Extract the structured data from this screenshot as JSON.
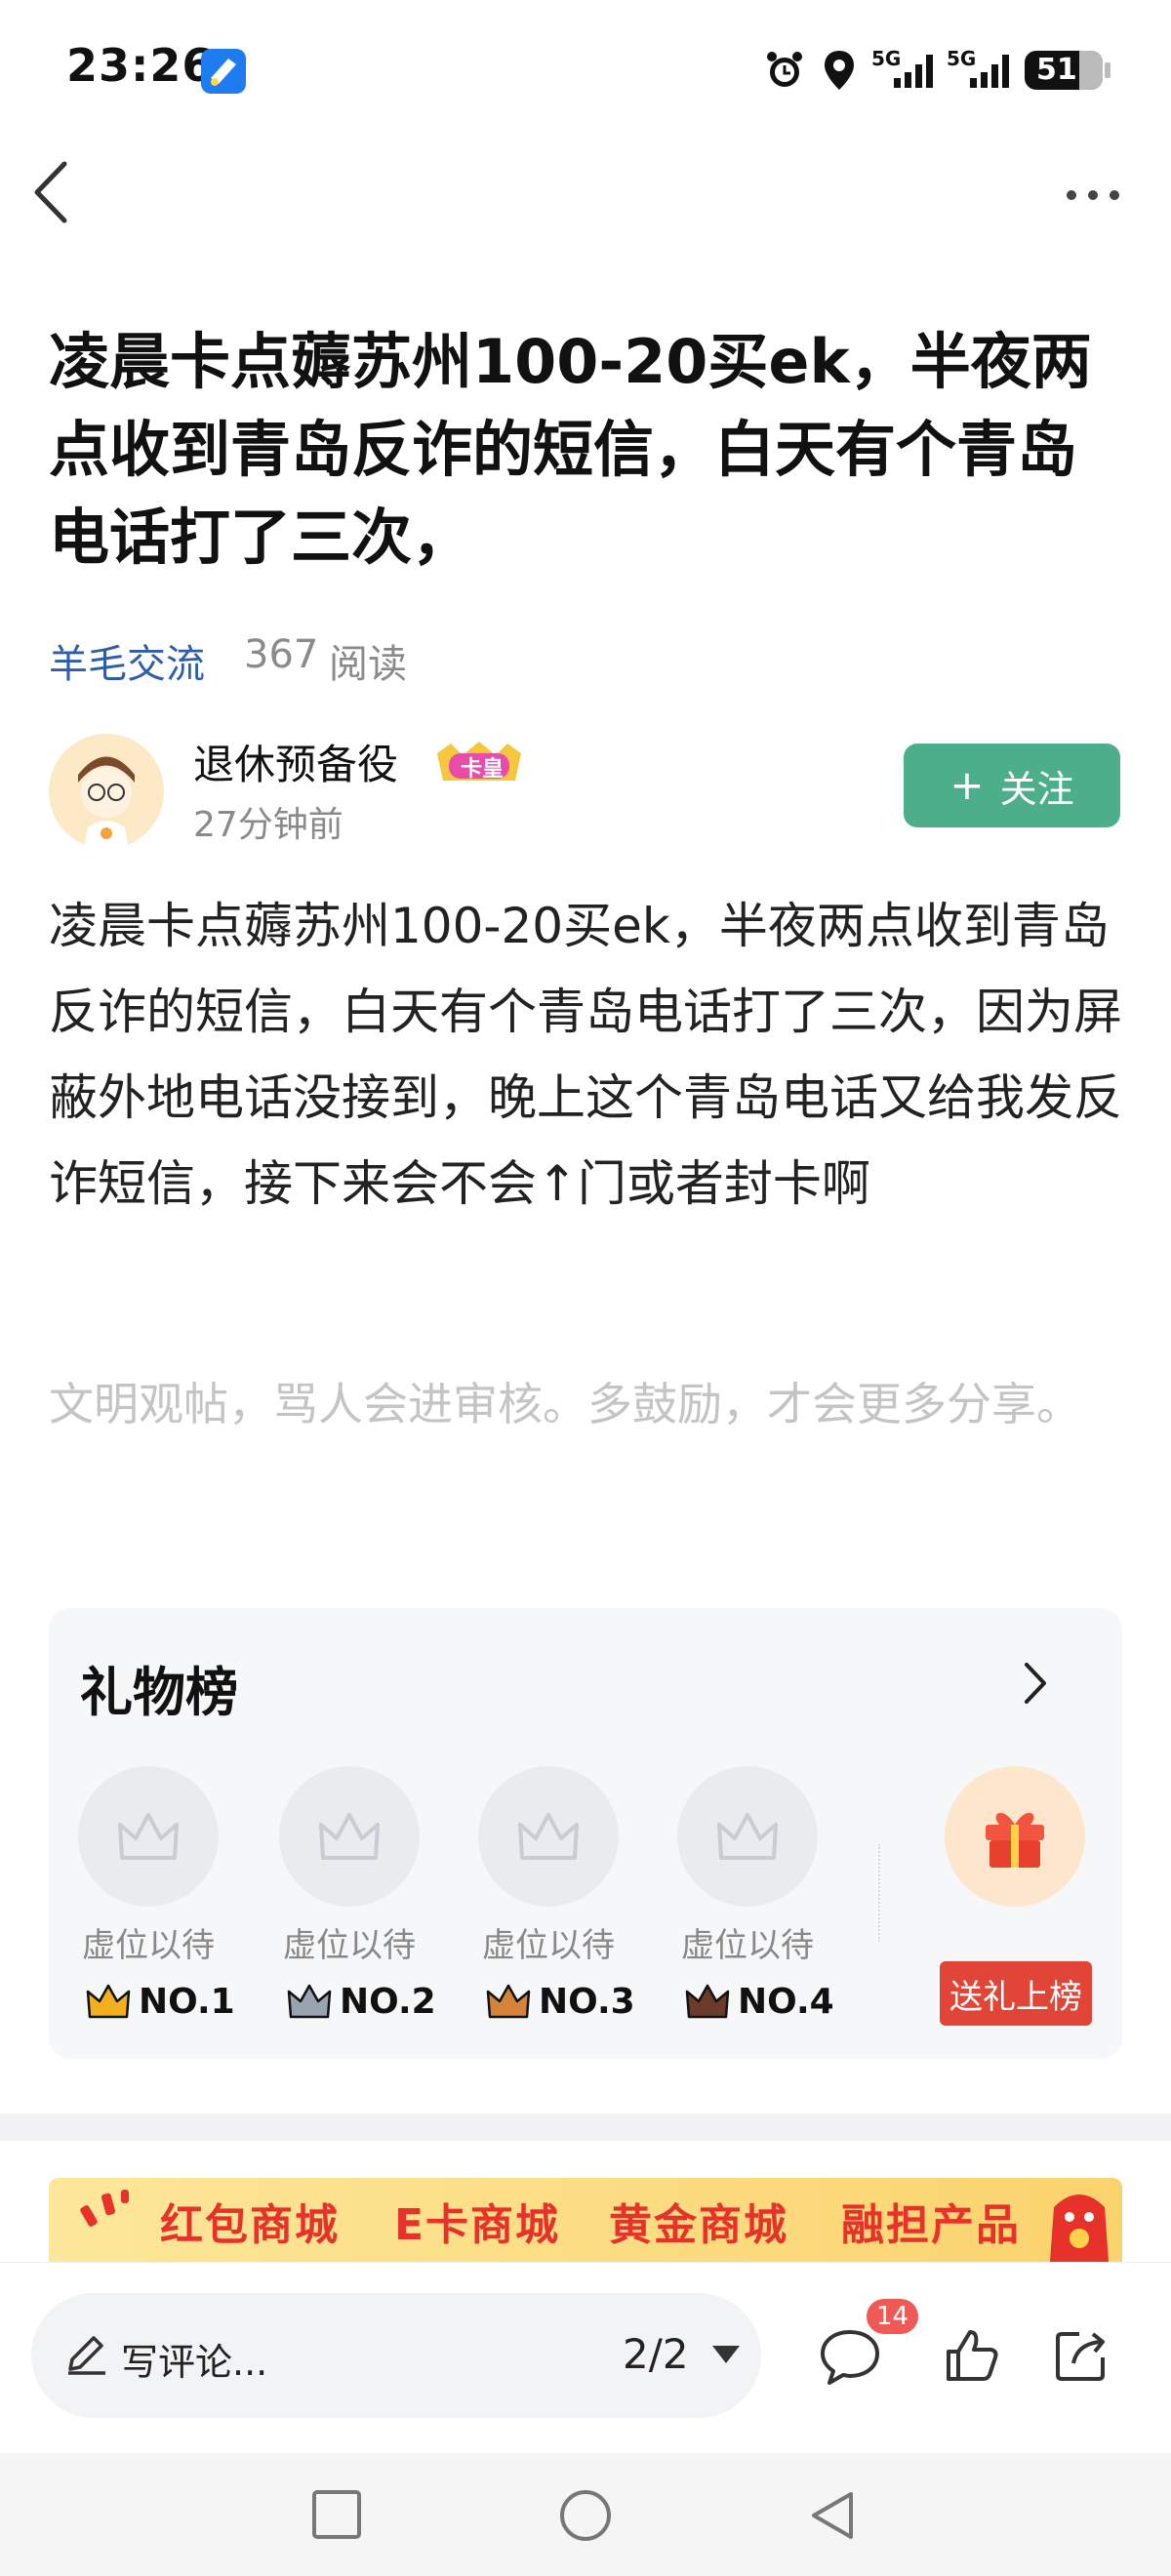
{
  "status_bar": {
    "time": "23:26",
    "battery": "51",
    "signal_1": "5G",
    "signal_2": "5G"
  },
  "post": {
    "title": "凌晨卡点薅苏州100-20买ek，半夜两点收到青岛反诈的短信，白天有个青岛电话打了三次，",
    "category": "羊毛交流",
    "read_count": "367",
    "read_unit": "阅读",
    "author": "退休预备役",
    "author_badge": "卡皇",
    "time_ago": "27分钟前",
    "follow_label": "关注",
    "body": "凌晨卡点薅苏州100-20买ek，半夜两点收到青岛反诈的短信，白天有个青岛电话打了三次，因为屏蔽外地电话没接到，晚上这个青岛电话又给我发反诈短信，接下来会不会↑门或者封卡啊",
    "notice": "文明观帖，骂人会进审核。多鼓励，才会更多分享。"
  },
  "gift_board": {
    "title": "礼物榜",
    "slots": [
      {
        "label": "虚位以待",
        "rank": "NO.1",
        "crown_color": "#f2b01e"
      },
      {
        "label": "虚位以待",
        "rank": "NO.2",
        "crown_color": "#9aa3b2"
      },
      {
        "label": "虚位以待",
        "rank": "NO.3",
        "crown_color": "#d5823b"
      },
      {
        "label": "虚位以待",
        "rank": "NO.4",
        "crown_color": "#6b3a2a"
      }
    ],
    "send_label": "送礼上榜"
  },
  "banner": {
    "items": [
      "红包商城",
      "E卡商城",
      "黄金商城",
      "融担产品"
    ]
  },
  "bottom_bar": {
    "comment_placeholder": "写评论...",
    "pager": "2/2",
    "comment_count": "14"
  }
}
